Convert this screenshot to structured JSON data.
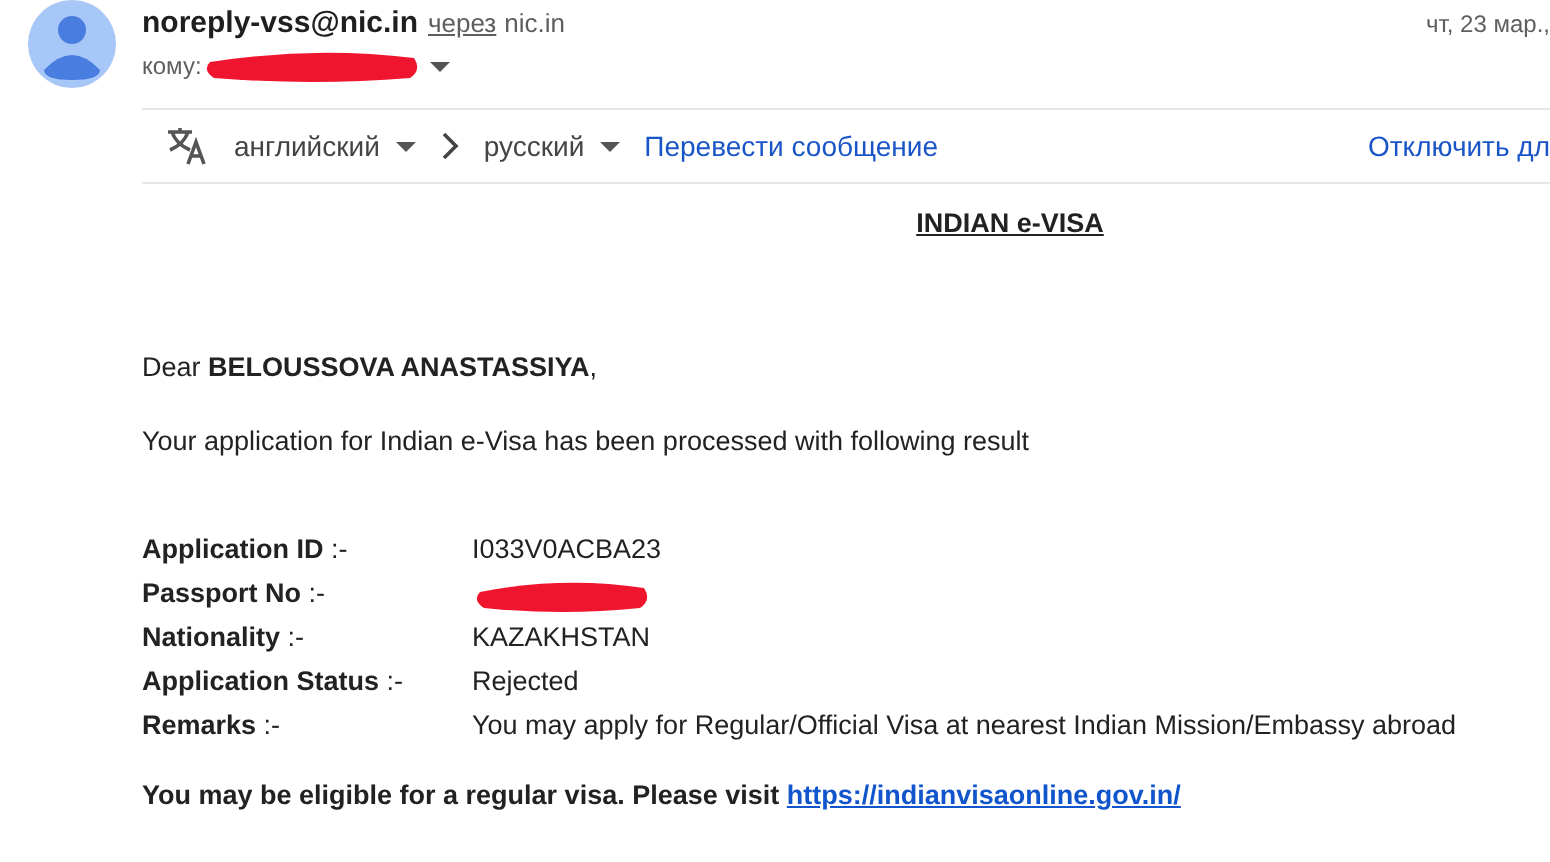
{
  "header": {
    "sender": "noreply-vss@nic.in",
    "via_label": "через",
    "via_domain": "nic.in",
    "date": "чт, 23 мар.,",
    "to_label": "кому:"
  },
  "translate_bar": {
    "source_language": "английский",
    "target_language": "русский",
    "translate_link": "Перевести сообщение",
    "disable_link": "Отключить дл"
  },
  "email": {
    "title": "INDIAN e-VISA",
    "greeting": "Dear **BELOUSSOVA ANASTASSIYA**,",
    "intro": "Your application for Indian e-Visa has been processed with following result",
    "details": [
      {
        "label": "**Application ID** :-",
        "value": "I033V0ACBA23",
        "redacted": false
      },
      {
        "label": "**Passport No** :-",
        "redacted": true
      },
      {
        "label": "**Nationality** :-",
        "value": "KAZAKHSTAN",
        "redacted": false
      },
      {
        "label": "**Application Status** :-",
        "value": "Rejected",
        "redacted": false
      },
      {
        "label": "**Remarks** :-",
        "value": "You may apply for Regular/Official Visa at nearest Indian Mission/Embassy abroad",
        "redacted": false
      }
    ],
    "footer_text": "You may be eligible for a regular visa. Please visit",
    "footer_link": "https://indianvisaonline.gov.in/"
  }
}
